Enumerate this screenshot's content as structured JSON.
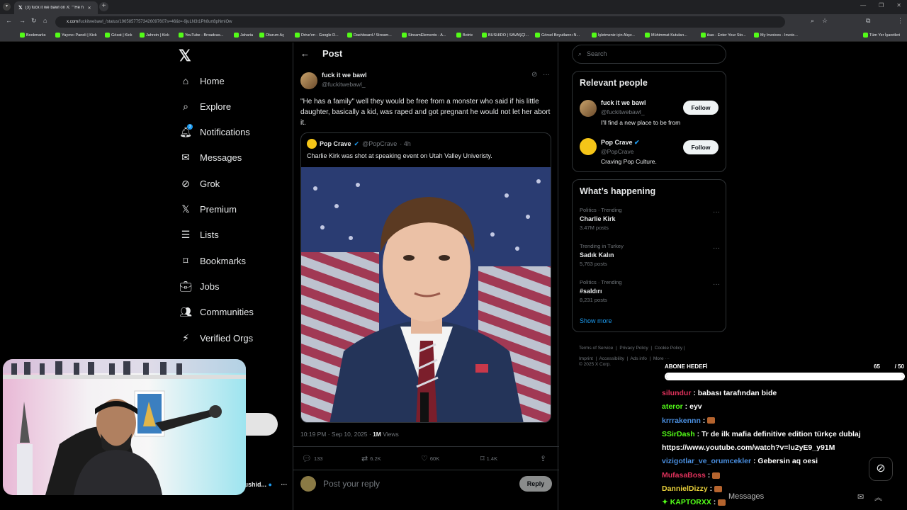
{
  "browser": {
    "tab_title": "(3) fuck it we bawl on X: \"\"He h",
    "url_host": "x.com",
    "url_path": "/fuckitwebawl_/status/19658577573426097607s=46&t=-9juLN3t1Ph8urt8pNmiOw",
    "bookmarks": [
      "Bookmarks",
      "Yayıncı Paneli | Kick",
      "Gözat | Kick",
      "Jahrein | Kick",
      "YouTube - Broadcas...",
      "Jaharia",
      "Oturum Aç",
      "Drive'ım - Google D...",
      "Dashboard / Stream...",
      "StreamElements - A...",
      "Botrix",
      "BUSHIDO | SAVAŞÇI...",
      "Görsel Boyutlarını N...",
      "İşletmeniz için Alışv...",
      "Mühimmat Kutuları...",
      "ikas - Enter Your Sto...",
      "My Invoices - Invoic...",
      "Tüm Yer İşaretleri"
    ]
  },
  "nav": {
    "items": [
      {
        "label": "Home",
        "icon": "home-icon"
      },
      {
        "label": "Explore",
        "icon": "search-icon"
      },
      {
        "label": "Notifications",
        "icon": "bell-icon",
        "badge": "3"
      },
      {
        "label": "Messages",
        "icon": "envelope-icon"
      },
      {
        "label": "Grok",
        "icon": "grok-icon"
      },
      {
        "label": "Premium",
        "icon": "x-logo-icon"
      },
      {
        "label": "Lists",
        "icon": "list-icon"
      },
      {
        "label": "Bookmarks",
        "icon": "bookmark-icon"
      },
      {
        "label": "Jobs",
        "icon": "briefcase-icon"
      },
      {
        "label": "Communities",
        "icon": "people-icon"
      },
      {
        "label": "Verified Orgs",
        "icon": "lightning-icon"
      }
    ],
    "account_name": "Bushid..."
  },
  "post": {
    "header": "Post",
    "author": "fuck it we bawl",
    "handle": "@fuckitwebawl_",
    "text": "\"He has a family\" well they would be free from a monster who said if his little daughter, basically a kid, was raped and got pregnant he would not let her abort it.",
    "quote": {
      "author": "Pop Crave",
      "handle": "@PopCrave",
      "time": "· 4h",
      "text": "Charlie Kirk was shot at speaking event on Utah Valley Univeristy."
    },
    "time": "10:19 PM · Sep 10, 2025 · ",
    "views_count": "1M",
    "views_label": " Views",
    "stats": {
      "replies": "133",
      "reposts": "6.2K",
      "likes": "60K",
      "bookmarks": "1.4K"
    },
    "reply_placeholder": "Post your reply",
    "reply_button": "Reply"
  },
  "sidebar": {
    "search_placeholder": "Search",
    "relevant_title": "Relevant people",
    "people": [
      {
        "name": "fuck it we bawl",
        "handle": "@fuckitwebawl_",
        "bio": "I'll find a new place to be from",
        "button": "Follow"
      },
      {
        "name": "Pop Crave",
        "handle": "@PopCrave",
        "bio": "Craving Pop Culture.",
        "button": "Follow"
      }
    ],
    "happening_title": "What’s happening",
    "trends": [
      {
        "context": "Politics · Trending",
        "name": "Charlie Kirk",
        "count": "3.47M posts"
      },
      {
        "context": "Trending in Turkey",
        "name": "Sadık Kalın",
        "count": "5,763 posts"
      },
      {
        "context": "Politics · Trending",
        "name": "#saldırı",
        "count": "8,231 posts"
      }
    ],
    "show_more": "Show more",
    "footer_links": [
      "Terms of Service",
      "Privacy Policy",
      "Cookie Policy",
      "Imprint",
      "Accessibility",
      "Ads info",
      "More ···"
    ],
    "copyright": "© 2025 X Corp."
  },
  "overlay": {
    "goal_label": "ABONE HEDEFİ",
    "goal_current": "65",
    "goal_total": "/ 50",
    "goal_fraction": 1.0,
    "chat": [
      {
        "user": "silundur",
        "color": "#e0325c",
        "msg": "babası tarafından bide"
      },
      {
        "user": "ateror",
        "color": "#53fc18",
        "msg": "eyv"
      },
      {
        "user": "krrrakennn",
        "color": "#4a8fe0",
        "msg": ""
      },
      {
        "user": "SSirDash",
        "color": "#53fc18",
        "msg": "Tr de ilk mafia definitive edition türkçe dublaj"
      },
      {
        "user": "",
        "color": "#ffffff",
        "msg": "https://www.youtube.com/watch?v=lu2yE9_y91M"
      },
      {
        "user": "vizigotlar_ve_orumcekler",
        "color": "#4a8fe0",
        "msg": "Gebersin aq oesi"
      },
      {
        "user": "MufasaBoss",
        "color": "#e0325c",
        "msg": ""
      },
      {
        "user": "DannielDizzy",
        "color": "#e8d03a",
        "msg": ""
      },
      {
        "user": "KAPTORXX",
        "color": "#53fc18",
        "msg": ""
      }
    ],
    "messages_label": "Messages"
  }
}
